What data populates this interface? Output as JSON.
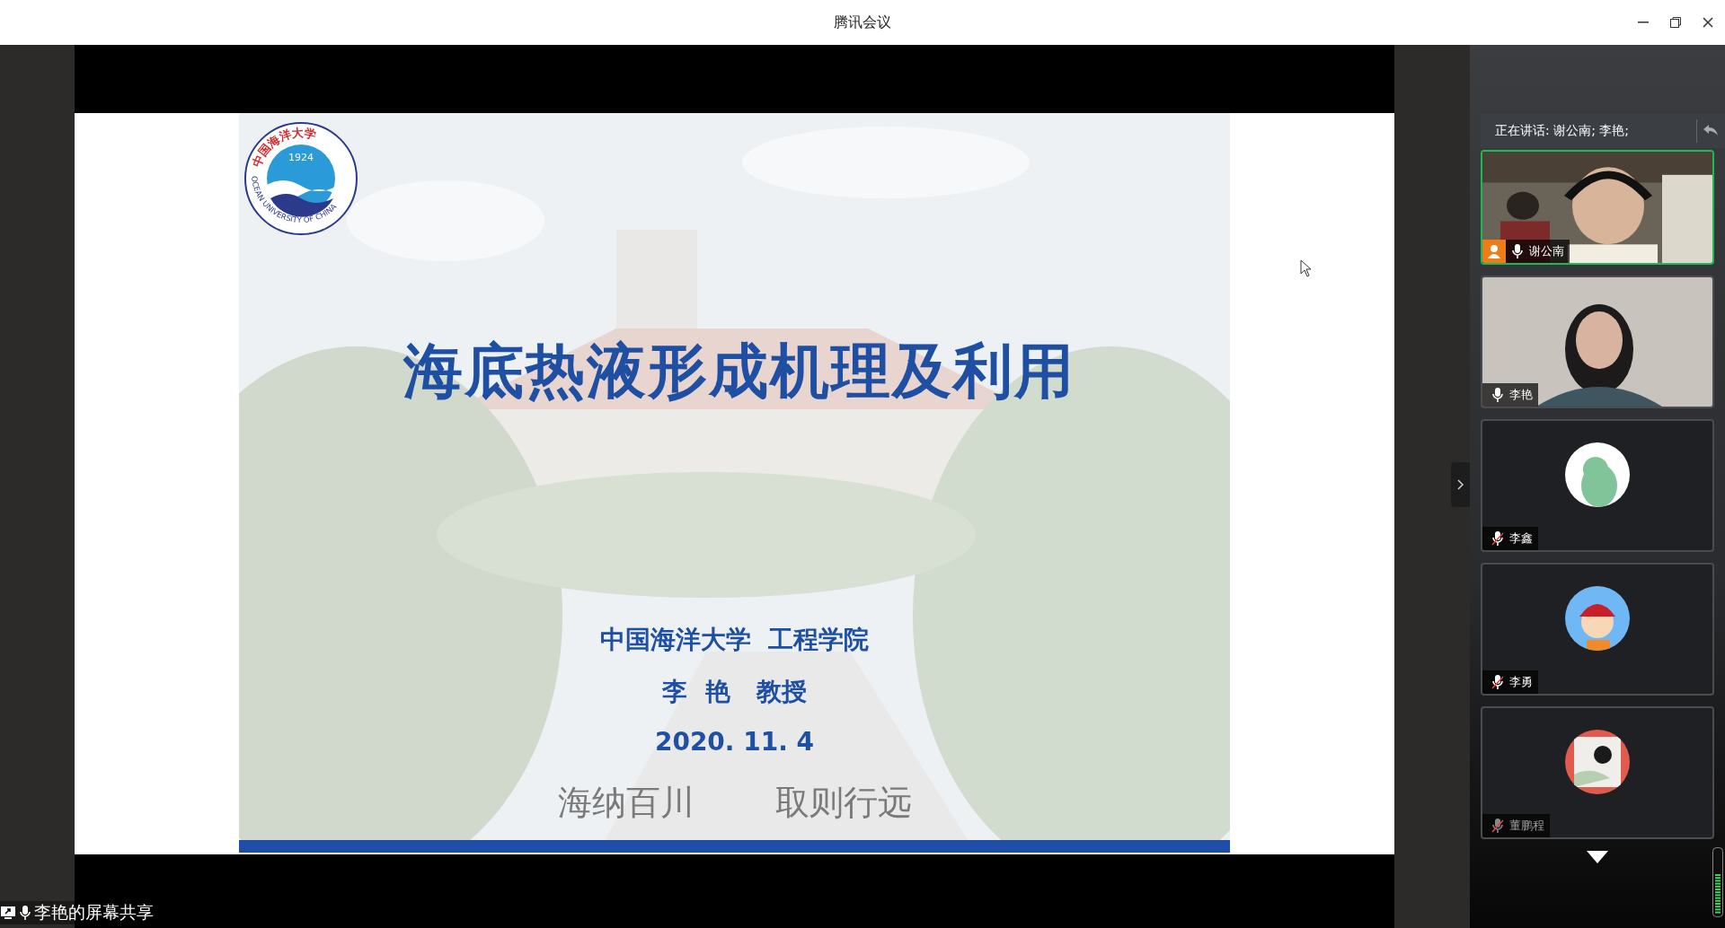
{
  "window": {
    "title": "腾讯会议"
  },
  "slide": {
    "logo": {
      "ring_cn": "中国海洋大学",
      "year": "1924",
      "ring_en": "OCEAN UNIVERSITY OF CHINA"
    },
    "title": "海底热液形成机理及利用",
    "affiliation": "中国海洋大学  工程学院",
    "presenter": "李  艳   教授",
    "date": "2020. 11. 4",
    "motto": [
      "海纳百川",
      "取则行远"
    ]
  },
  "speaking": {
    "text": "正在讲话: 谢公南; 李艳;"
  },
  "participants": [
    {
      "name": "谢公南",
      "kind": "video",
      "muted": false,
      "host": true,
      "active": true,
      "dimmed": false
    },
    {
      "name": "李艳",
      "kind": "video",
      "muted": false,
      "host": false,
      "active": false,
      "dimmed": false
    },
    {
      "name": "李鑫",
      "kind": "avatar",
      "muted": true,
      "host": false,
      "active": false,
      "dimmed": false
    },
    {
      "name": "李勇",
      "kind": "avatar",
      "muted": true,
      "host": false,
      "active": false,
      "dimmed": false
    },
    {
      "name": "董鹏程",
      "kind": "avatar",
      "muted": true,
      "host": false,
      "active": false,
      "dimmed": true
    }
  ],
  "share_label": "李艳的屏幕共享"
}
